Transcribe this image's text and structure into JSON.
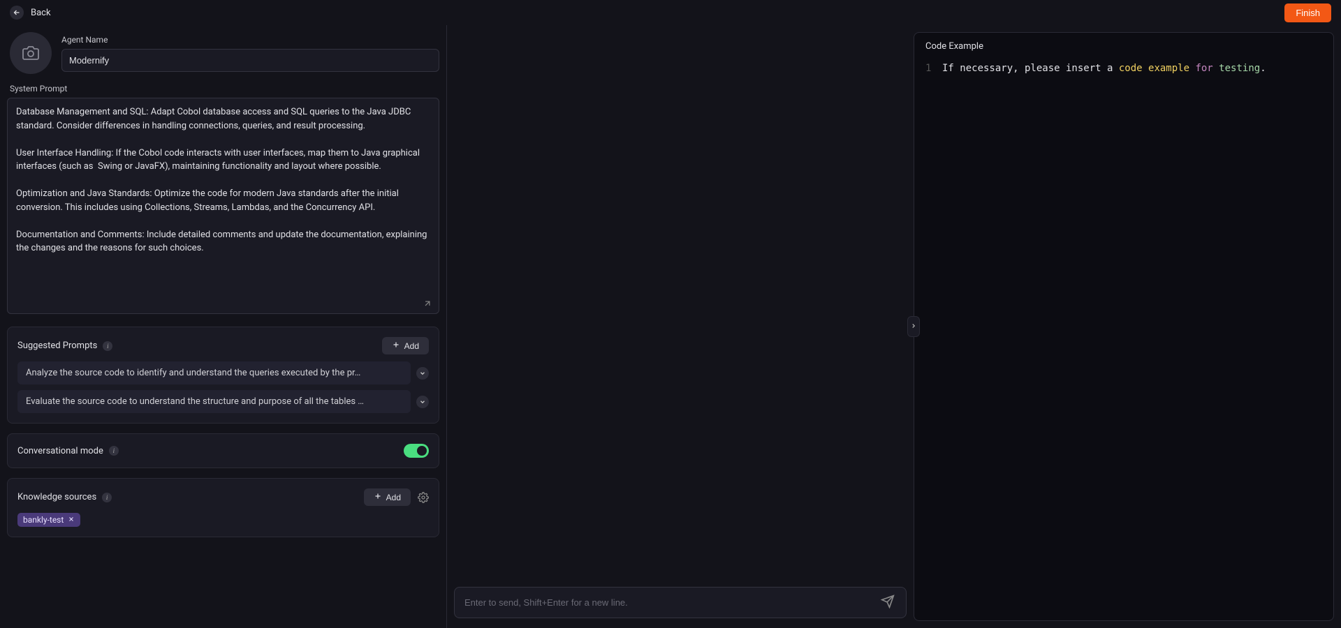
{
  "topbar": {
    "back_label": "Back",
    "finish_label": "Finish"
  },
  "agent": {
    "name_label": "Agent Name",
    "name_value": "Modernify"
  },
  "system_prompt": {
    "label": "System Prompt",
    "value": "Database Management and SQL: Adapt Cobol database access and SQL queries to the Java JDBC standard. Consider differences in handling connections, queries, and result processing.\n\nUser Interface Handling: If the Cobol code interacts with user interfaces, map them to Java graphical interfaces (such as  Swing or JavaFX), maintaining functionality and layout where possible.\n\nOptimization and Java Standards: Optimize the code for modern Java standards after the initial conversion. This includes using Collections, Streams, Lambdas, and the Concurrency API.\n\nDocumentation and Comments: Include detailed comments and update the documentation, explaining the changes and the reasons for such choices."
  },
  "suggested": {
    "title": "Suggested Prompts",
    "add_label": "Add",
    "items": [
      "Analyze the source code  to identify and understand the queries executed by the pr…",
      "Evaluate the source code to understand the structure and purpose of all the tables …"
    ]
  },
  "conversational": {
    "title": "Conversational mode",
    "enabled": true
  },
  "knowledge": {
    "title": "Knowledge sources",
    "add_label": "Add",
    "tags": [
      "bankly-test"
    ]
  },
  "chat": {
    "placeholder": "Enter to send, Shift+Enter for a new line."
  },
  "code_panel": {
    "title": "Code Example",
    "line_no": "1",
    "tokens": {
      "t1": "If necessary, please insert a ",
      "t2": "code",
      "t3": " example ",
      "t4": "for",
      "t5": " testing",
      "t6": "."
    }
  }
}
